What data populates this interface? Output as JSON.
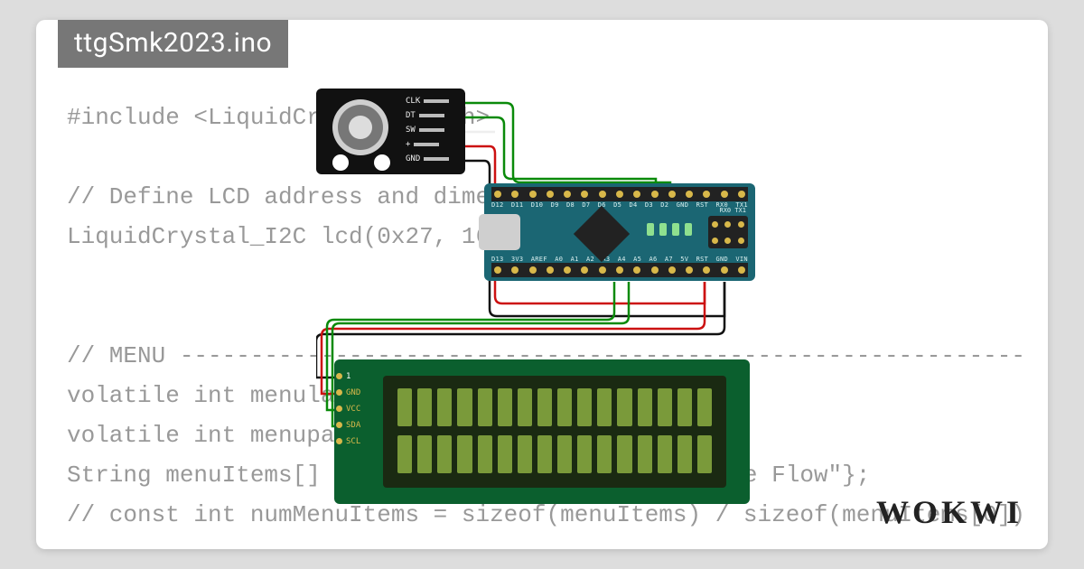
{
  "title": "ttgSmk2023.ino",
  "brand": "WOKWI",
  "code_lines": [
    "#include <LiquidCrystal_I2C.h>",
    "",
    "// Define LCD address and dimensions",
    "LiquidCrystal_I2C lcd(0x27, 16, 2);",
    "",
    "",
    "// MENU -----------------------------------------------------------------------------",
    "volatile int menulayer = 0;",
    "volatile int menupage = 0;",
    "String menuItems[] = {\"Co                       e Flow\"};",
    "// const int numMenuItems = sizeof(menuItems) / sizeof(menuItems[0]);"
  ],
  "encoder_pins": [
    "CLK",
    "DT",
    "SW",
    "+",
    "GND"
  ],
  "nano_top_labels": [
    "D12",
    "D11",
    "D10",
    "D9",
    "D8",
    "D7",
    "D6",
    "D5",
    "D4",
    "D3",
    "D2",
    "GND",
    "RST",
    "RX0",
    "TX1"
  ],
  "nano_bottom_labels": [
    "D13",
    "3V3",
    "AREF",
    "A0",
    "A1",
    "A2",
    "A3",
    "A4",
    "A5",
    "A6",
    "A7",
    "5V",
    "RST",
    "GND",
    "VIN"
  ],
  "nano_end_label": "RX0 TX1",
  "lcd_pins": [
    "GND",
    "VCC",
    "SDA",
    "SCL"
  ],
  "lcd_pin_header": "1",
  "wire_colors": {
    "gnd": "#111111",
    "vcc": "#cc1111",
    "sig": "#0a8a0a",
    "white": "#eeeeee"
  }
}
